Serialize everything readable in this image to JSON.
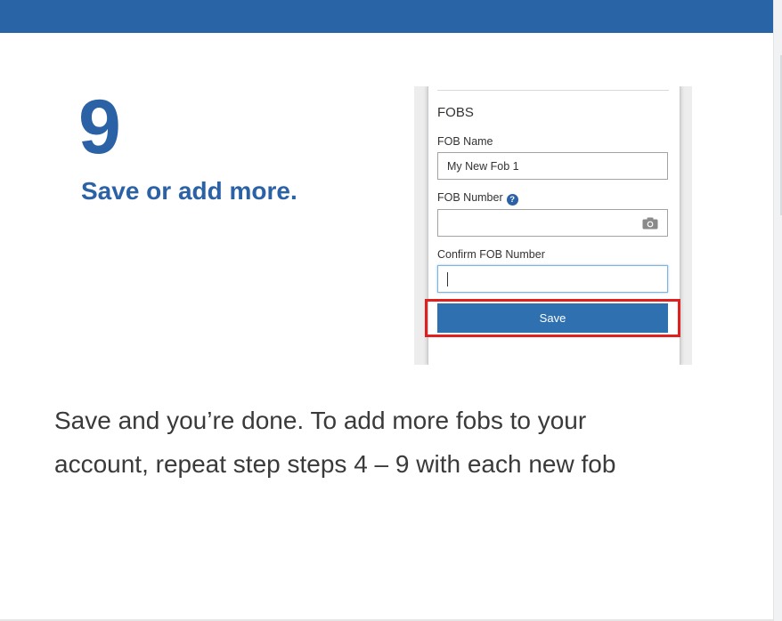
{
  "step": {
    "number": "9",
    "title": "Save or add more."
  },
  "phone": {
    "section_title": "FOBS",
    "fob_name_label": "FOB Name",
    "fob_name_value": "My New Fob 1",
    "fob_number_label": "FOB Number",
    "help_glyph": "?",
    "confirm_label": "Confirm FOB Number",
    "save_label": "Save"
  },
  "description": {
    "line1": "Save and you’re done. To add more fobs to your",
    "line2": "account, repeat step steps 4 – 9 with each new fob"
  },
  "colors": {
    "brand_blue": "#2964a7",
    "button_blue": "#2f71b0",
    "highlight_red": "#e0201f"
  },
  "icons": [
    "help-icon",
    "camera-icon"
  ]
}
